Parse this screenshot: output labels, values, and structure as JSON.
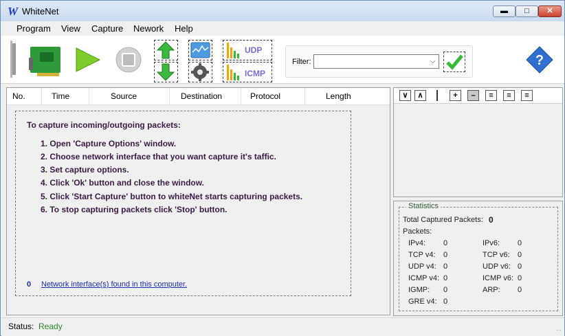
{
  "window": {
    "title": "WhiteNet",
    "icon_glyph": "W"
  },
  "menu": [
    "Program",
    "View",
    "Capture",
    "Nework",
    "Help"
  ],
  "toolbar": {
    "udp_label": "UDP",
    "icmp_label": "ICMP",
    "filter_label": "Filter:",
    "filter_value": ""
  },
  "grid": {
    "columns": [
      "No.",
      "Time",
      "Source",
      "Destination",
      "Protocol",
      "Length"
    ]
  },
  "instructions": {
    "title": "To capture incoming/outgoing packets:",
    "steps": [
      "1. Open 'Capture Options' window.",
      "2. Choose network interface that you want capture it's taffic.",
      "3. Set capture options.",
      "4. Click 'Ok' button and close the window.",
      "5. Click 'Start Capture' button to whiteNet starts capturing packets.",
      "6. To stop capturing packets click 'Stop' button."
    ],
    "interface_count": "0",
    "interface_link": "Network interface(s) found in this computer."
  },
  "statistics": {
    "title": "Statistics",
    "total_label": "Total Captured Packets:",
    "total_value": "0",
    "packets_label": "Packets:",
    "left": [
      {
        "label": "IPv4:",
        "value": "0"
      },
      {
        "label": "TCP v4:",
        "value": "0"
      },
      {
        "label": "UDP v4:",
        "value": "0"
      },
      {
        "label": "ICMP v4:",
        "value": "0"
      },
      {
        "label": "IGMP:",
        "value": "0"
      },
      {
        "label": "GRE v4:",
        "value": "0"
      }
    ],
    "right": [
      {
        "label": "IPv6:",
        "value": "0"
      },
      {
        "label": "TCP v6:",
        "value": "0"
      },
      {
        "label": "UDP v6:",
        "value": "0"
      },
      {
        "label": "ICMP v6:",
        "value": "0"
      },
      {
        "label": "ARP:",
        "value": "0"
      }
    ]
  },
  "status": {
    "label": "Status:",
    "value": "Ready"
  },
  "icons": {
    "nic": "network-card-icon",
    "start": "play-icon",
    "stop": "stop-icon",
    "sort_up": "arrow-up-icon",
    "sort_down": "arrow-down-icon",
    "graph": "graph-icon",
    "settings": "gear-icon",
    "udp": "udp-chart-icon",
    "icmp": "icmp-chart-icon",
    "apply": "checkmark-icon",
    "help": "help-icon"
  },
  "colors": {
    "accent_green": "#2a8a2a",
    "link_blue": "#1a2db0",
    "instruction_text": "#3a1a45"
  }
}
